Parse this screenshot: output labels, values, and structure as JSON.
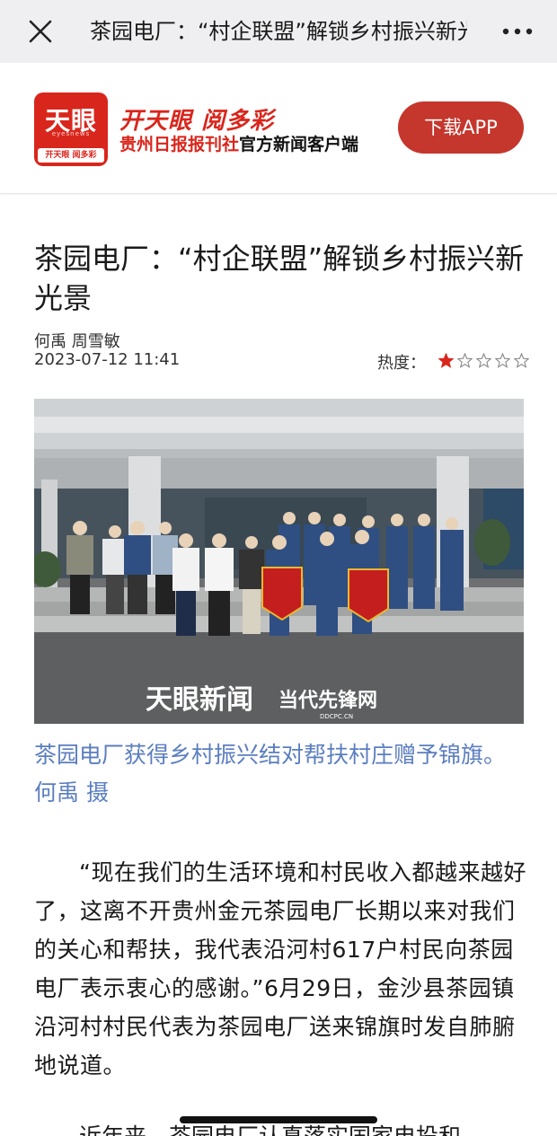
{
  "nav": {
    "title": "茶园电厂：“村企联盟”解锁乡村振兴新光景"
  },
  "banner": {
    "logo_text": "天眼",
    "logo_sub": "eyesnews",
    "logo_foot": "开天眼 阅多彩",
    "slogan": "开天眼 阅多彩",
    "tagline_red": "贵州日报报刊社",
    "tagline_black": "官方新闻客户端",
    "download_label": "下载APP"
  },
  "article": {
    "title": "茶园电厂：“村企联盟”解锁乡村振兴新光景",
    "authors": "何禹 周雪敏",
    "date": "2023-07-12 11:41",
    "heat_label": "热度：",
    "heat_rating": 1,
    "heat_max": 5,
    "photo_watermark_left": "天眼新闻",
    "photo_watermark_right": "当代先锋网",
    "photo_watermark_url": "DDCPC.CN",
    "caption": "茶园电厂获得乡村振兴结对帮扶村庄赠予锦旗。何禹 摄",
    "paragraph_1": "“现在我们的生活环境和村民收入都越来越好了，这离不开贵州金元茶园电厂长期以来对我们的关心和帮扶，我代表沿河村617户村民向茶园电厂表示衷心的感谢。”6月29日，金沙县茶园镇沿河村村民代表为茶园电厂送来锦旗时发自肺腑地说道。",
    "paragraph_2": "近年来，茶园电厂认真落实国家电投和"
  },
  "colors": {
    "brand_red": "#d9261c",
    "button_red": "#c5362c",
    "caption_blue": "#5b7ec0",
    "navbar_bg": "#efeff1"
  }
}
